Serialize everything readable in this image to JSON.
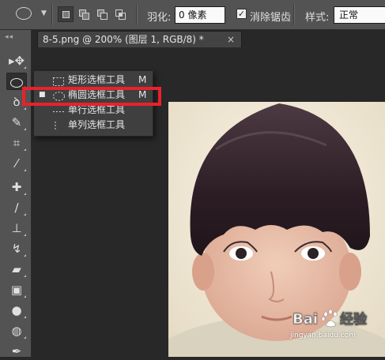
{
  "options_bar": {
    "feather_label": "羽化:",
    "feather_value": "0 像素",
    "antialias_label": "消除锯齿",
    "antialias_checked": true,
    "style_label": "样式:",
    "style_value": "正常"
  },
  "document_tab": {
    "title": "8-5.png @ 200% (图层 1, RGB/8) *",
    "close_glyph": "×"
  },
  "flyout": {
    "items": [
      {
        "label": "矩形选框工具",
        "shortcut": "M",
        "icon": "rect-marquee-icon",
        "selected": false
      },
      {
        "label": "椭圆选框工具",
        "shortcut": "M",
        "icon": "ellipse-marquee-icon",
        "selected": true
      },
      {
        "label": "单行选框工具",
        "shortcut": "",
        "icon": "single-row-marquee-icon",
        "selected": false
      },
      {
        "label": "单列选框工具",
        "shortcut": "",
        "icon": "single-column-marquee-icon",
        "selected": false
      }
    ],
    "bullet": "■"
  },
  "watermark": {
    "logo_text": "Bai 经验",
    "url": "jingyan.baidu.com"
  },
  "colors": {
    "highlight_box": "#e8222c",
    "panel_bg": "#535353",
    "workspace_bg": "#282828"
  }
}
